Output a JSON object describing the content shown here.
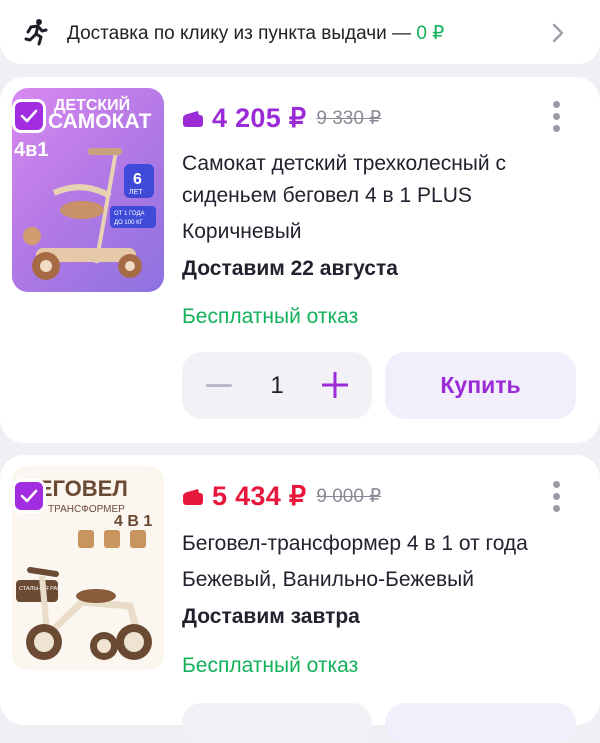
{
  "banner": {
    "text": "Доставка по клику из пункта выдачи — ",
    "price": "0 ₽",
    "icon": "running-person-icon"
  },
  "products": [
    {
      "image_alt": "scooter",
      "image_text": [
        "ДЕТСКИЙ",
        "САМОКАТ",
        "4в1",
        "6",
        "ЛЕТ",
        "ОТ 1 ГОДА",
        "ДО 100 КГ"
      ],
      "price": "4 205 ₽",
      "old_price": "9 330 ₽",
      "price_color": "#9a2bd6",
      "title": "Самокат детский трехколесный с сиденьем беговел 4 в 1 PLUS",
      "variant": "Коричневый",
      "delivery": "Доставим 22 августа",
      "refund": "Бесплатный отказ",
      "quantity": "1",
      "buy_label": "Купить"
    },
    {
      "image_alt": "balance bike",
      "image_text": [
        "БЕГОВЕЛ",
        "ТРАНСФОРМЕР",
        "4 В 1",
        "СТАЛЬНАЯ РАМА"
      ],
      "price": "5 434 ₽",
      "old_price": "9 000 ₽",
      "price_color": "#e8173c",
      "title": "Беговел-трансформер 4 в 1 от года",
      "variant": "Бежевый, Ванильно-Бежевый",
      "delivery": "Доставим завтра",
      "refund": "Бесплатный отказ"
    }
  ],
  "colors": {
    "accent": "#a12ce0",
    "success": "#12b15a",
    "discount_red": "#e8173c"
  }
}
